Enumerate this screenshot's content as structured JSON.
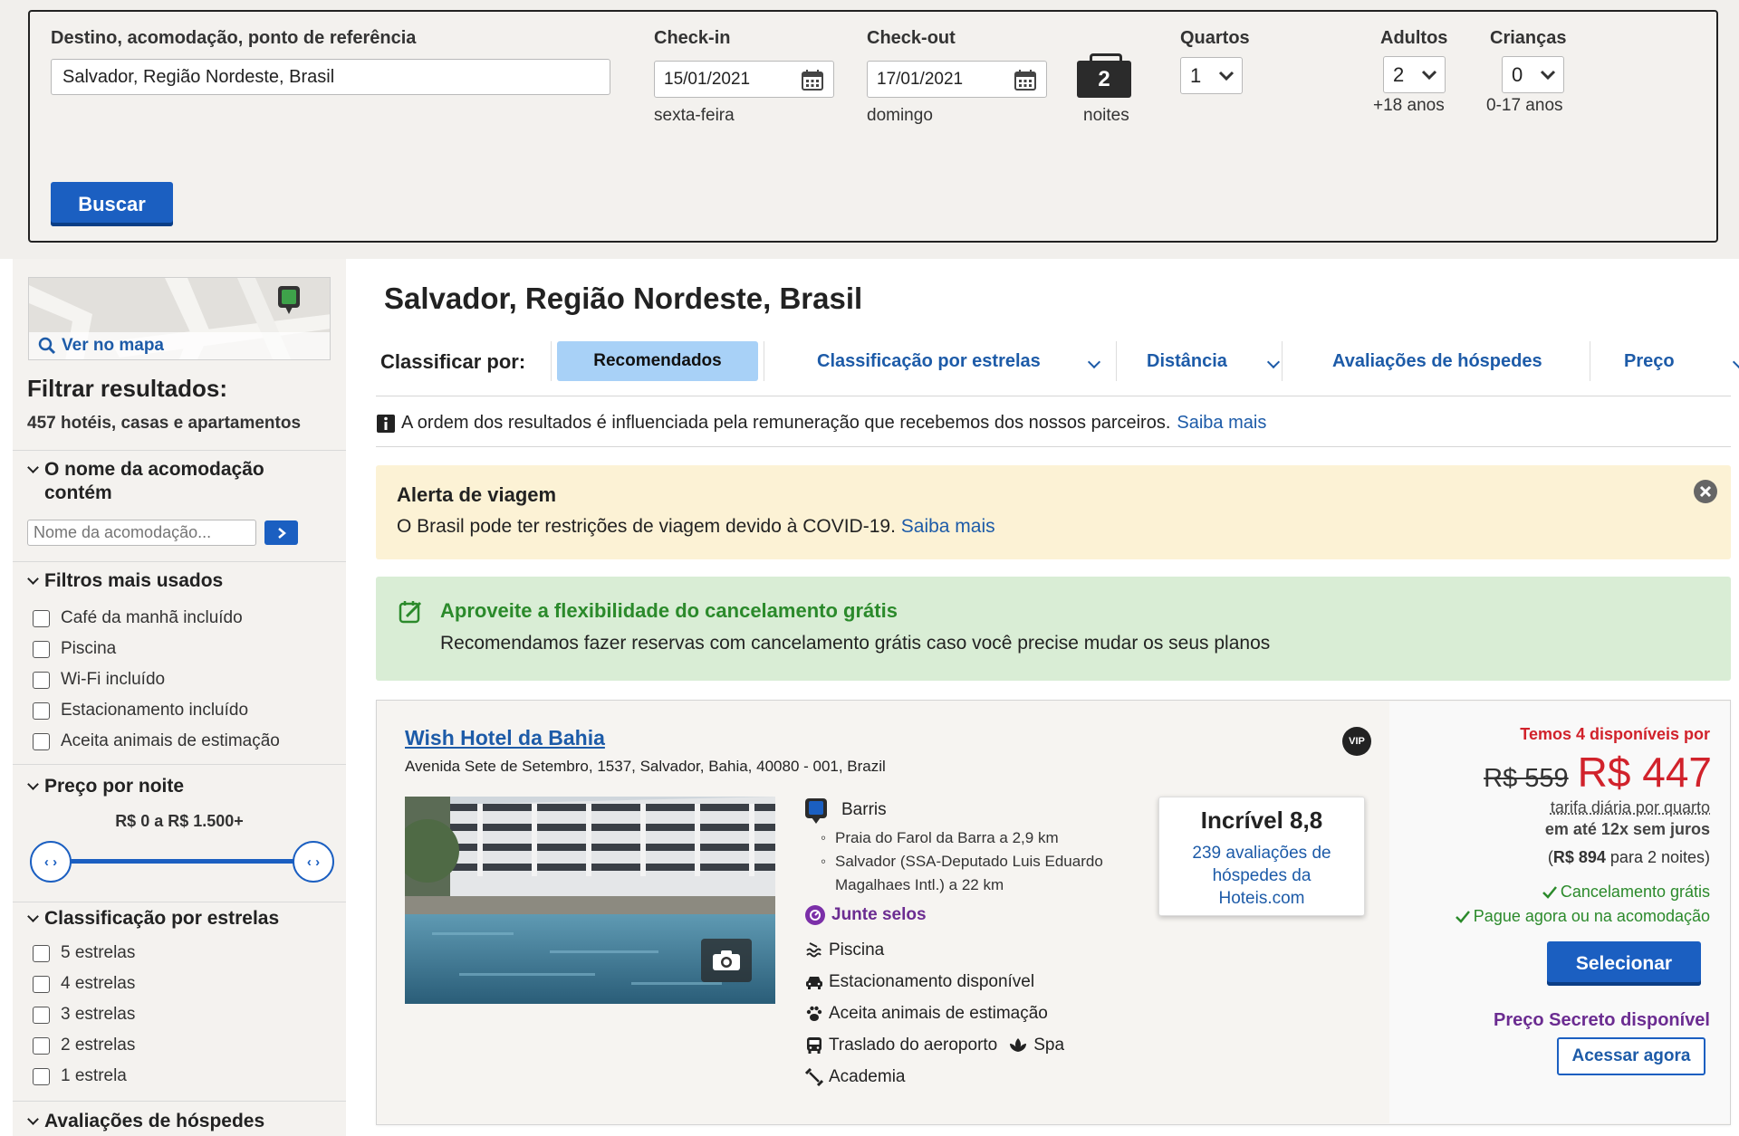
{
  "search": {
    "destination_label": "Destino, acomodação, ponto de referência",
    "destination_value": "Salvador, Região Nordeste, Brasil",
    "checkin_label": "Check-in",
    "checkin_value": "15/01/2021",
    "checkin_day": "sexta-feira",
    "checkout_label": "Check-out",
    "checkout_value": "17/01/2021",
    "checkout_day": "domingo",
    "nights_value": "2",
    "nights_label": "noites",
    "rooms_label": "Quartos",
    "rooms_value": "1",
    "adults_label": "Adultos",
    "adults_value": "2",
    "adults_sub": "+18 anos",
    "children_label": "Crianças",
    "children_value": "0",
    "children_sub": "0-17 anos",
    "search_button": "Buscar"
  },
  "sidebar": {
    "map_link": "Ver no mapa",
    "filter_title": "Filtrar resultados:",
    "result_count": "457 hotéis, casas e apartamentos",
    "name_section": "O nome da acomodação contém",
    "name_placeholder": "Nome da acomodação...",
    "popular_section": "Filtros mais usados",
    "popular_filters": [
      "Café da manhã incluído",
      "Piscina",
      "Wi-Fi incluído",
      "Estacionamento incluído",
      "Aceita animais de estimação"
    ],
    "price_section": "Preço por noite",
    "price_range": "R$ 0 a R$ 1.500+",
    "price_slider": {
      "min_fraction": 0,
      "max_fraction": 1
    },
    "stars_section": "Classificação por estrelas",
    "star_filters": [
      "5 estrelas",
      "4 estrelas",
      "3 estrelas",
      "2 estrelas",
      "1 estrela"
    ],
    "reviews_section": "Avaliações de hóspedes"
  },
  "main": {
    "title": "Salvador, Região Nordeste, Brasil",
    "sort_label": "Classificar por:",
    "sort_options": [
      "Recomendados",
      "Classificação por estrelas",
      "Distância",
      "Avaliações de hóspedes",
      "Preço"
    ],
    "sort_active": "Recomendados",
    "notice_text": "A ordem dos resultados é influenciada pela remuneração que recebemos dos nossos parceiros.",
    "notice_link": "Saiba mais",
    "travel_alert": {
      "title": "Alerta de viagem",
      "text": "O Brasil pode ter restrições de viagem devido à COVID-19.",
      "link": "Saiba mais"
    },
    "cancel_banner": {
      "title": "Aproveite a flexibilidade do cancelamento grátis",
      "text": "Recomendamos fazer reservas com cancelamento grátis caso você precise mudar os seus planos",
      "title_color": "#2b8a2b"
    }
  },
  "hotel": {
    "name": "Wish Hotel da Bahia",
    "address": "Avenida Sete de Setembro, 1537, Salvador, Bahia, 40080 - 001, Brazil",
    "badge": "VIP",
    "neighborhood": "Barris",
    "landmarks": [
      "Praia do Farol da Barra a 2,9 km",
      "Salvador (SSA-Deputado Luis Eduardo Magalhaes Intl.) a 22 km"
    ],
    "rewards": "Junte selos",
    "amenities": [
      "Piscina",
      "Estacionamento disponível",
      "Aceita animais de estimação",
      "Traslado do aeroporto",
      "Spa",
      "Academia"
    ],
    "rating_title": "Incrível 8,8",
    "rating_reviews": "239 avaliações de hóspedes da Hoteis.com",
    "availability": "Temos 4 disponíveis por",
    "old_price": "R$ 559",
    "price": "R$ 447",
    "price_note": "tarifa diária por quarto",
    "installments": "em até 12x sem juros",
    "total_price": "R$ 894",
    "total_suffix": "para 2 noites",
    "free_cancel": "Cancelamento grátis",
    "pay_option": "Pague agora ou na acomodação",
    "select_button": "Selecionar",
    "secret_price": "Preço Secreto disponível",
    "access_button": "Acessar agora",
    "colors": {
      "price_red": "#d1222b",
      "secret_purple": "#6b2c91",
      "check_green": "#2b8a2b"
    }
  }
}
